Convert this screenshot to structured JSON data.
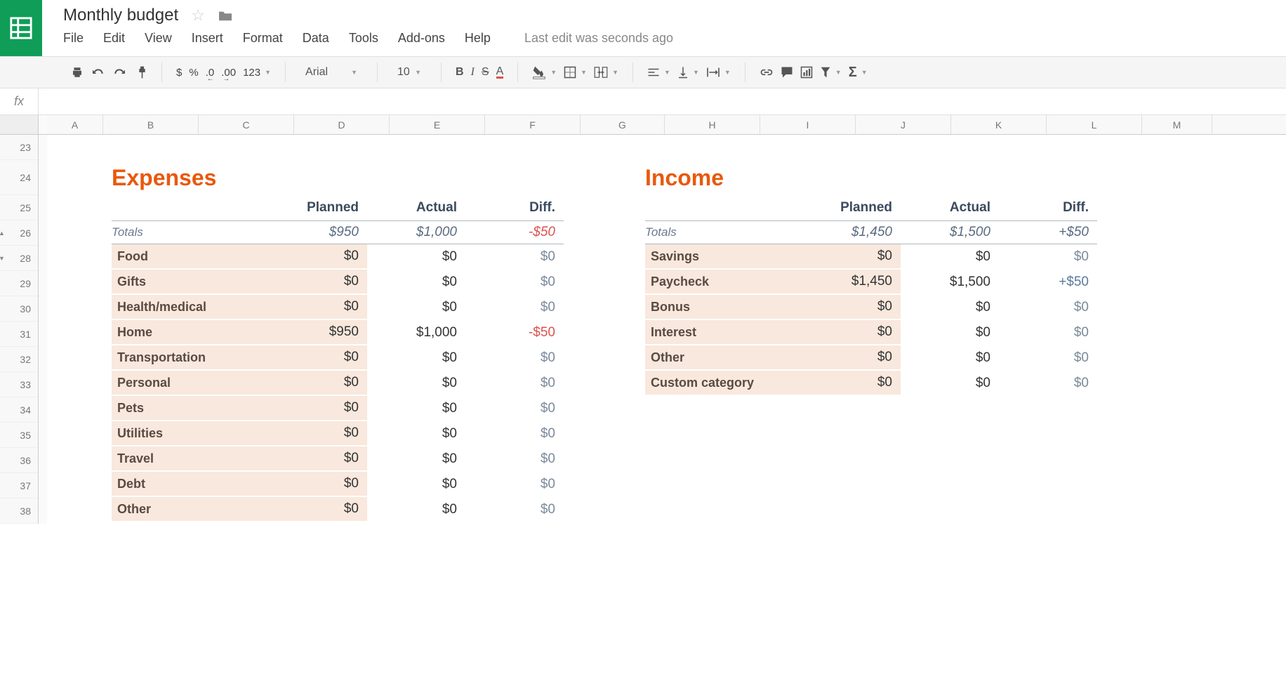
{
  "app": {
    "title": "Monthly budget",
    "last_edit": "Last edit was seconds ago"
  },
  "menu": {
    "file": "File",
    "edit": "Edit",
    "view": "View",
    "insert": "Insert",
    "format": "Format",
    "data": "Data",
    "tools": "Tools",
    "addons": "Add-ons",
    "help": "Help"
  },
  "toolbar": {
    "currency": "$",
    "percent": "%",
    "dec_dec": ".0",
    "dec_inc": ".00",
    "format_more": "123",
    "font": "Arial",
    "font_size": "10",
    "bold": "B",
    "italic": "I",
    "strike": "S",
    "text_color": "A"
  },
  "columns": [
    "A",
    "B",
    "C",
    "D",
    "E",
    "F",
    "G",
    "H",
    "I",
    "J",
    "K",
    "L",
    "M"
  ],
  "rows": [
    "23",
    "24",
    "25",
    "26",
    "28",
    "29",
    "30",
    "31",
    "32",
    "33",
    "34",
    "35",
    "36",
    "37",
    "38"
  ],
  "sections": {
    "expenses_title": "Expenses",
    "income_title": "Income",
    "planned": "Planned",
    "actual": "Actual",
    "diff": "Diff.",
    "totals": "Totals"
  },
  "expenses": {
    "totals": {
      "planned": "$950",
      "actual": "$1,000",
      "diff": "-$50"
    },
    "rows": [
      {
        "cat": "Food",
        "planned": "$0",
        "actual": "$0",
        "diff": "$0"
      },
      {
        "cat": "Gifts",
        "planned": "$0",
        "actual": "$0",
        "diff": "$0"
      },
      {
        "cat": "Health/medical",
        "planned": "$0",
        "actual": "$0",
        "diff": "$0"
      },
      {
        "cat": "Home",
        "planned": "$950",
        "actual": "$1,000",
        "diff": "-$50"
      },
      {
        "cat": "Transportation",
        "planned": "$0",
        "actual": "$0",
        "diff": "$0"
      },
      {
        "cat": "Personal",
        "planned": "$0",
        "actual": "$0",
        "diff": "$0"
      },
      {
        "cat": "Pets",
        "planned": "$0",
        "actual": "$0",
        "diff": "$0"
      },
      {
        "cat": "Utilities",
        "planned": "$0",
        "actual": "$0",
        "diff": "$0"
      },
      {
        "cat": "Travel",
        "planned": "$0",
        "actual": "$0",
        "diff": "$0"
      },
      {
        "cat": "Debt",
        "planned": "$0",
        "actual": "$0",
        "diff": "$0"
      },
      {
        "cat": "Other",
        "planned": "$0",
        "actual": "$0",
        "diff": "$0"
      }
    ]
  },
  "income": {
    "totals": {
      "planned": "$1,450",
      "actual": "$1,500",
      "diff": "+$50"
    },
    "rows": [
      {
        "cat": "Savings",
        "planned": "$0",
        "actual": "$0",
        "diff": "$0"
      },
      {
        "cat": "Paycheck",
        "planned": "$1,450",
        "actual": "$1,500",
        "diff": "+$50"
      },
      {
        "cat": "Bonus",
        "planned": "$0",
        "actual": "$0",
        "diff": "$0"
      },
      {
        "cat": "Interest",
        "planned": "$0",
        "actual": "$0",
        "diff": "$0"
      },
      {
        "cat": "Other",
        "planned": "$0",
        "actual": "$0",
        "diff": "$0"
      },
      {
        "cat": "Custom category",
        "planned": "$0",
        "actual": "$0",
        "diff": "$0"
      }
    ]
  }
}
